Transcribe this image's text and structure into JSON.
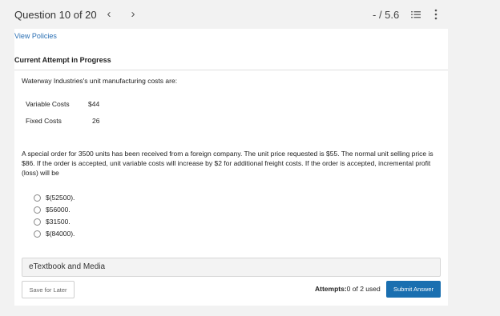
{
  "header": {
    "question_counter": "Question 10 of 20",
    "prev_glyph": "‹",
    "next_glyph": "›",
    "score": "- / 5.6"
  },
  "view_policies": "View Policies",
  "attempt_heading": "Current Attempt in Progress",
  "question": {
    "intro": "Waterway Industries's unit manufacturing costs are:",
    "costs": [
      {
        "label": "Variable Costs",
        "value": "$44"
      },
      {
        "label": "Fixed Costs",
        "value": "26"
      }
    ],
    "prompt": "A special order for 3500 units has been received from a foreign company. The unit price requested is $55. The normal unit selling price is $86. If the order is accepted, unit variable costs will increase by $2 for additional freight costs. If the order is accepted, incremental profit (loss) will be",
    "options": [
      "$(52500).",
      "$56000.",
      "$31500.",
      "$(84000)."
    ]
  },
  "etextbook_label": "eTextbook and Media",
  "footer": {
    "save_label": "Save for Later",
    "attempts_label": "Attempts:",
    "attempts_value": "0 of 2 used",
    "submit_label": "Submit Answer"
  },
  "colors": {
    "accent": "#1a6fb0",
    "link": "#2a6fb3",
    "background": "#f2f2f2"
  },
  "icons": [
    "chevron-left-icon",
    "chevron-right-icon",
    "list-icon",
    "kebab-menu-icon",
    "radio-icon"
  ]
}
